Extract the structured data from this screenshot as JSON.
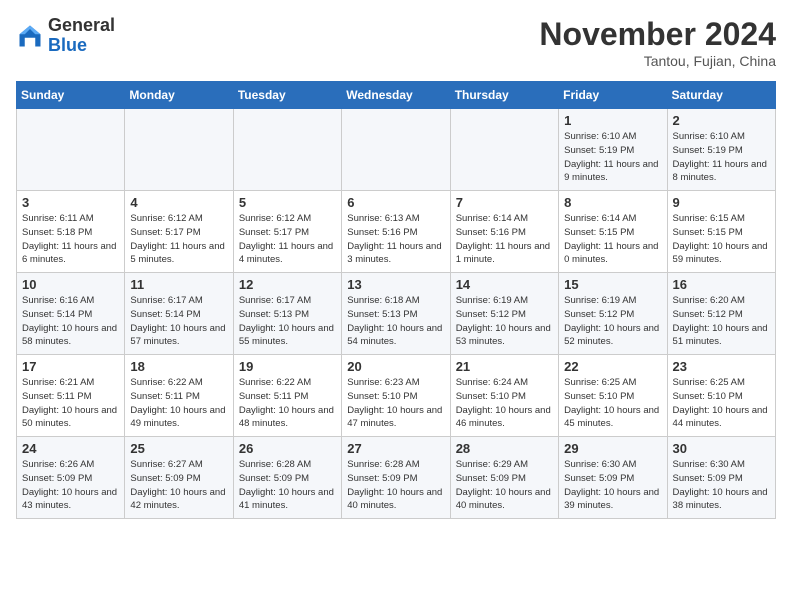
{
  "logo": {
    "general": "General",
    "blue": "Blue"
  },
  "title": "November 2024",
  "location": "Tantou, Fujian, China",
  "headers": [
    "Sunday",
    "Monday",
    "Tuesday",
    "Wednesday",
    "Thursday",
    "Friday",
    "Saturday"
  ],
  "weeks": [
    [
      {
        "day": "",
        "info": ""
      },
      {
        "day": "",
        "info": ""
      },
      {
        "day": "",
        "info": ""
      },
      {
        "day": "",
        "info": ""
      },
      {
        "day": "",
        "info": ""
      },
      {
        "day": "1",
        "info": "Sunrise: 6:10 AM\nSunset: 5:19 PM\nDaylight: 11 hours and 9 minutes."
      },
      {
        "day": "2",
        "info": "Sunrise: 6:10 AM\nSunset: 5:19 PM\nDaylight: 11 hours and 8 minutes."
      }
    ],
    [
      {
        "day": "3",
        "info": "Sunrise: 6:11 AM\nSunset: 5:18 PM\nDaylight: 11 hours and 6 minutes."
      },
      {
        "day": "4",
        "info": "Sunrise: 6:12 AM\nSunset: 5:17 PM\nDaylight: 11 hours and 5 minutes."
      },
      {
        "day": "5",
        "info": "Sunrise: 6:12 AM\nSunset: 5:17 PM\nDaylight: 11 hours and 4 minutes."
      },
      {
        "day": "6",
        "info": "Sunrise: 6:13 AM\nSunset: 5:16 PM\nDaylight: 11 hours and 3 minutes."
      },
      {
        "day": "7",
        "info": "Sunrise: 6:14 AM\nSunset: 5:16 PM\nDaylight: 11 hours and 1 minute."
      },
      {
        "day": "8",
        "info": "Sunrise: 6:14 AM\nSunset: 5:15 PM\nDaylight: 11 hours and 0 minutes."
      },
      {
        "day": "9",
        "info": "Sunrise: 6:15 AM\nSunset: 5:15 PM\nDaylight: 10 hours and 59 minutes."
      }
    ],
    [
      {
        "day": "10",
        "info": "Sunrise: 6:16 AM\nSunset: 5:14 PM\nDaylight: 10 hours and 58 minutes."
      },
      {
        "day": "11",
        "info": "Sunrise: 6:17 AM\nSunset: 5:14 PM\nDaylight: 10 hours and 57 minutes."
      },
      {
        "day": "12",
        "info": "Sunrise: 6:17 AM\nSunset: 5:13 PM\nDaylight: 10 hours and 55 minutes."
      },
      {
        "day": "13",
        "info": "Sunrise: 6:18 AM\nSunset: 5:13 PM\nDaylight: 10 hours and 54 minutes."
      },
      {
        "day": "14",
        "info": "Sunrise: 6:19 AM\nSunset: 5:12 PM\nDaylight: 10 hours and 53 minutes."
      },
      {
        "day": "15",
        "info": "Sunrise: 6:19 AM\nSunset: 5:12 PM\nDaylight: 10 hours and 52 minutes."
      },
      {
        "day": "16",
        "info": "Sunrise: 6:20 AM\nSunset: 5:12 PM\nDaylight: 10 hours and 51 minutes."
      }
    ],
    [
      {
        "day": "17",
        "info": "Sunrise: 6:21 AM\nSunset: 5:11 PM\nDaylight: 10 hours and 50 minutes."
      },
      {
        "day": "18",
        "info": "Sunrise: 6:22 AM\nSunset: 5:11 PM\nDaylight: 10 hours and 49 minutes."
      },
      {
        "day": "19",
        "info": "Sunrise: 6:22 AM\nSunset: 5:11 PM\nDaylight: 10 hours and 48 minutes."
      },
      {
        "day": "20",
        "info": "Sunrise: 6:23 AM\nSunset: 5:10 PM\nDaylight: 10 hours and 47 minutes."
      },
      {
        "day": "21",
        "info": "Sunrise: 6:24 AM\nSunset: 5:10 PM\nDaylight: 10 hours and 46 minutes."
      },
      {
        "day": "22",
        "info": "Sunrise: 6:25 AM\nSunset: 5:10 PM\nDaylight: 10 hours and 45 minutes."
      },
      {
        "day": "23",
        "info": "Sunrise: 6:25 AM\nSunset: 5:10 PM\nDaylight: 10 hours and 44 minutes."
      }
    ],
    [
      {
        "day": "24",
        "info": "Sunrise: 6:26 AM\nSunset: 5:09 PM\nDaylight: 10 hours and 43 minutes."
      },
      {
        "day": "25",
        "info": "Sunrise: 6:27 AM\nSunset: 5:09 PM\nDaylight: 10 hours and 42 minutes."
      },
      {
        "day": "26",
        "info": "Sunrise: 6:28 AM\nSunset: 5:09 PM\nDaylight: 10 hours and 41 minutes."
      },
      {
        "day": "27",
        "info": "Sunrise: 6:28 AM\nSunset: 5:09 PM\nDaylight: 10 hours and 40 minutes."
      },
      {
        "day": "28",
        "info": "Sunrise: 6:29 AM\nSunset: 5:09 PM\nDaylight: 10 hours and 40 minutes."
      },
      {
        "day": "29",
        "info": "Sunrise: 6:30 AM\nSunset: 5:09 PM\nDaylight: 10 hours and 39 minutes."
      },
      {
        "day": "30",
        "info": "Sunrise: 6:30 AM\nSunset: 5:09 PM\nDaylight: 10 hours and 38 minutes."
      }
    ]
  ]
}
